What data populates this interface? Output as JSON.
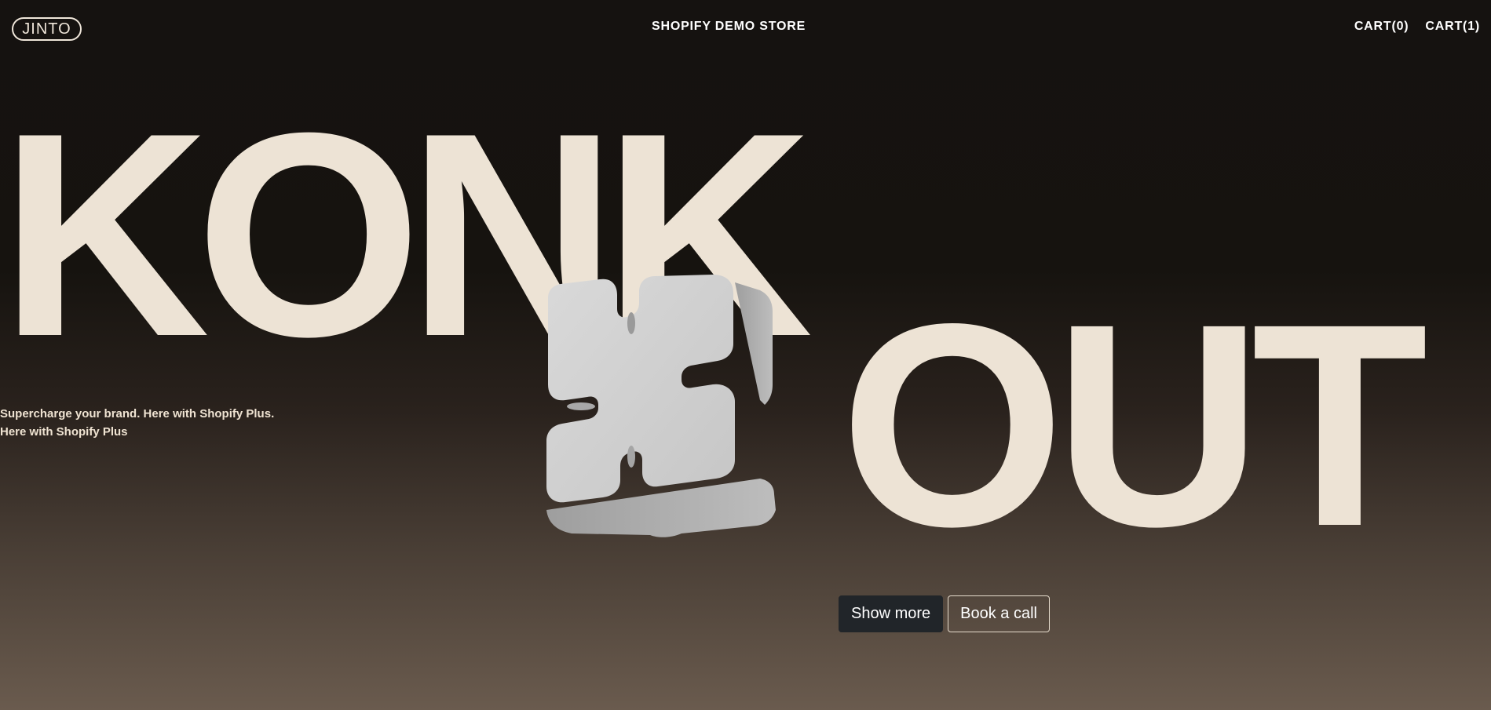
{
  "header": {
    "logo_text": "JINTO",
    "store_title": "SHOPIFY DEMO STORE",
    "cart_links": [
      "CART(0)",
      "CART(1)"
    ]
  },
  "hero": {
    "word_left": "KONK",
    "word_right": "OUT",
    "tagline_line1": "Supercharge your brand. Here with Shopify Plus.",
    "tagline_line2": "Here with Shopify Plus"
  },
  "actions": {
    "show_more_label": "Show more",
    "book_call_label": "Book a call"
  },
  "colors": {
    "headline": "#ede3d5",
    "background_top": "#151210",
    "background_bottom": "#6a5b4e",
    "primary_button": "#212529"
  }
}
